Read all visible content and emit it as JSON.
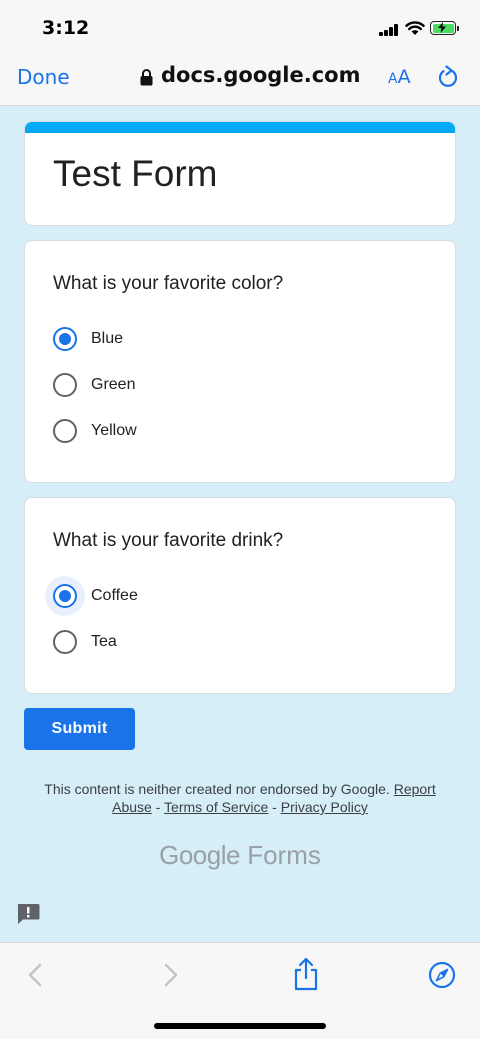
{
  "status": {
    "time": "3:12"
  },
  "browser": {
    "done_label": "Done",
    "url": "docs.google.com",
    "text_size_small": "A",
    "text_size_large": "A"
  },
  "form": {
    "title": "Test Form",
    "accent_color": "#03a9f4",
    "questions": [
      {
        "text": "What is your favorite color?",
        "options": [
          {
            "label": "Blue",
            "selected": true
          },
          {
            "label": "Green",
            "selected": false
          },
          {
            "label": "Yellow",
            "selected": false
          }
        ]
      },
      {
        "text": "What is your favorite drink?",
        "options": [
          {
            "label": "Coffee",
            "selected": true
          },
          {
            "label": "Tea",
            "selected": false
          }
        ]
      }
    ],
    "submit_label": "Submit"
  },
  "footer": {
    "disclaimer": "This content is neither created nor endorsed by Google.",
    "report_abuse": "Report Abuse",
    "sep1": "-",
    "terms": "Terms of Service",
    "sep2": "-",
    "privacy": "Privacy Policy",
    "brand_google": "Google",
    "brand_forms": "Forms"
  },
  "icons": {
    "lock": "lock-icon",
    "reload": "reload-icon",
    "feedback": "feedback-icon",
    "back": "back-arrow-icon",
    "forward": "forward-arrow-icon",
    "share": "share-icon",
    "safari": "compass-icon"
  }
}
